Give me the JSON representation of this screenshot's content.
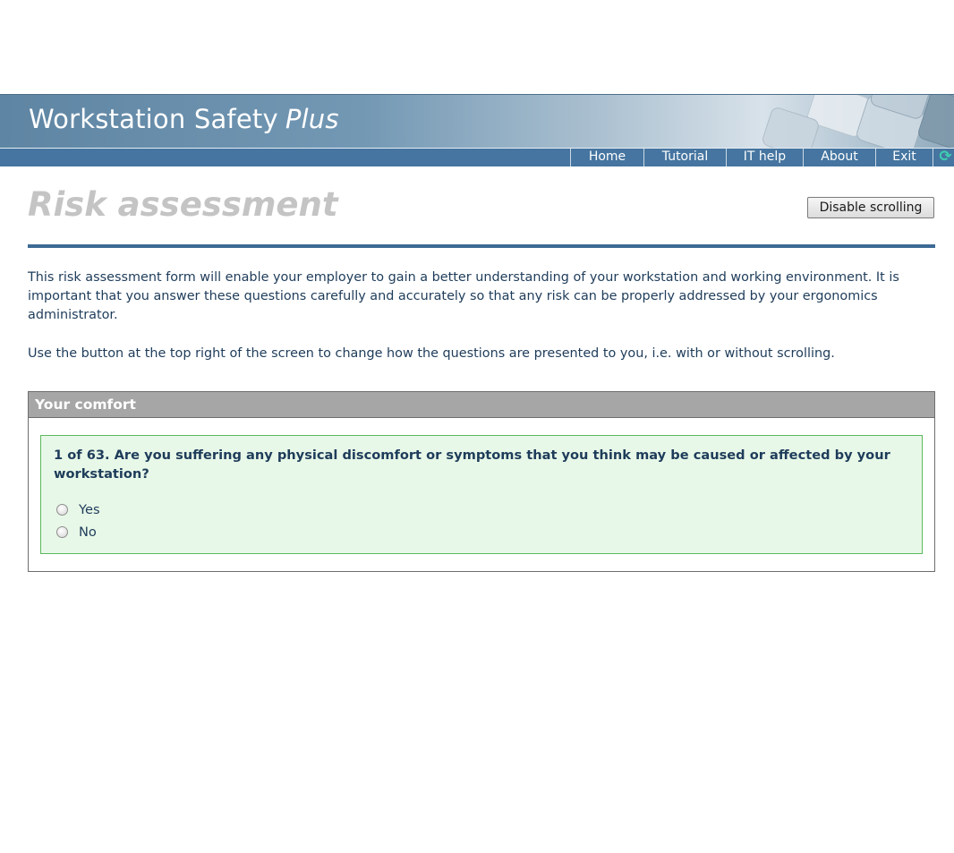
{
  "app": {
    "title": "Workstation Safety",
    "title_emphasis": "Plus"
  },
  "nav": {
    "items": [
      {
        "label": "Home"
      },
      {
        "label": "Tutorial"
      },
      {
        "label": "IT help"
      },
      {
        "label": "About"
      },
      {
        "label": "Exit"
      }
    ],
    "refresh_icon": "refresh-icon"
  },
  "page": {
    "title": "Risk assessment",
    "disable_scrolling_label": "Disable scrolling",
    "intro_paragraph_1": "This risk assessment form will enable your employer to gain a better understanding of your workstation and working environment. It is important that you answer these questions carefully and accurately so that any risk can be properly addressed by your ergonomics administrator.",
    "intro_paragraph_2": "Use the button at the top right of the screen to change how the questions are presented to you, i.e. with or without scrolling."
  },
  "section": {
    "title": "Your comfort",
    "question": {
      "text": "1 of 63. Are you suffering any physical discomfort or symptoms that you think may be caused or affected by your workstation?",
      "options": [
        {
          "label": "Yes",
          "selected": false
        },
        {
          "label": "No",
          "selected": false
        }
      ]
    }
  },
  "colors": {
    "nav_bar": "#4575a0",
    "rule": "#3d6a94",
    "page_title": "#c4c4c4",
    "section_header": "#a6a6a6",
    "question_bg": "#e8f8e8",
    "question_border": "#5cb85c",
    "text": "#1e3c5a"
  }
}
